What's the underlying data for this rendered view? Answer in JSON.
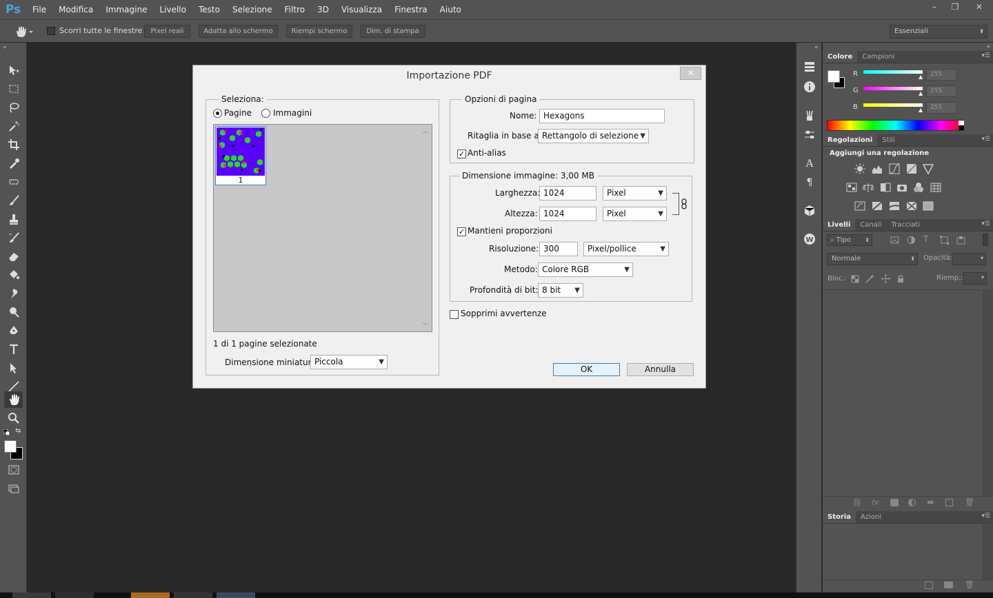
{
  "app": {
    "logo": "Ps"
  },
  "menu": [
    "File",
    "Modifica",
    "Immagine",
    "Livello",
    "Testo",
    "Selezione",
    "Filtro",
    "3D",
    "Visualizza",
    "Finestra",
    "Aiuto"
  ],
  "window_controls": [
    "–",
    "❐",
    "✕"
  ],
  "options_bar": {
    "scroll_all_label": "Scorri tutte le finestre",
    "buttons": [
      "Pixel reali",
      "Adatta allo schermo",
      "Riempi schermo",
      "Dim. di stampa"
    ],
    "workspace": "Essenziali"
  },
  "panels": {
    "color": {
      "tabs": [
        "Colore",
        "Campioni"
      ],
      "channels": [
        {
          "name": "R",
          "value": "255"
        },
        {
          "name": "G",
          "value": "255"
        },
        {
          "name": "B",
          "value": "255"
        }
      ]
    },
    "adjustments": {
      "tabs": [
        "Regolazioni",
        "Stili"
      ],
      "heading": "Aggiungi una regolazione"
    },
    "layers": {
      "tabs": [
        "Livelli",
        "Canali",
        "Tracciati"
      ],
      "filter_kind": "Tipo",
      "blend_mode": "Normale",
      "opacity_label": "Opacità:",
      "lock_label": "Bloc.:",
      "fill_label": "Riemp.:"
    },
    "history": {
      "tabs": [
        "Storia",
        "Azioni"
      ]
    }
  },
  "dialog": {
    "title": "Importazione PDF",
    "close": "✕",
    "select_group": {
      "title": "Seleziona:",
      "radio_pages": "Pagine",
      "radio_images": "Immagini",
      "pages_selected": true,
      "thumb_label": "1",
      "status": "1 di 1 pagine selezionate",
      "thumb_size_label": "Dimensione miniatura:",
      "thumb_size_value": "Piccola"
    },
    "page_options": {
      "title": "Opzioni di pagina",
      "name_label": "Nome:",
      "name_value": "Hexagons",
      "crop_label": "Ritaglia in base a:",
      "crop_value": "Rettangolo di selezione",
      "antialias_label": "Anti-alias",
      "antialias_checked": true
    },
    "image_size": {
      "title": "Dimensione immagine: 3,00 MB",
      "width_label": "Larghezza:",
      "width_value": "1024",
      "width_unit": "Pixel",
      "height_label": "Altezza:",
      "height_value": "1024",
      "height_unit": "Pixel",
      "constrain_label": "Mantieni proporzioni",
      "constrain_checked": true,
      "resolution_label": "Risoluzione:",
      "resolution_value": "300",
      "resolution_unit": "Pixel/pollice",
      "mode_label": "Metodo:",
      "mode_value": "Colore RGB",
      "depth_label": "Profondità di bit:",
      "depth_value": "8 bit"
    },
    "suppress_warnings_label": "Sopprimi avvertenze",
    "ok_label": "OK",
    "cancel_label": "Annulla"
  }
}
